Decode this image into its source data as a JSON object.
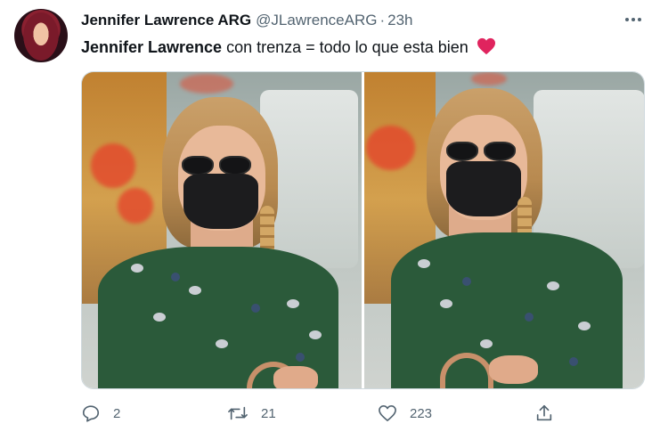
{
  "tweet": {
    "author_name": "Jennifer Lawrence ARG",
    "author_handle": "@JLawrenceARG",
    "separator": "·",
    "time": "23h",
    "text_mention": "Jennifer Lawrence",
    "text_rest": " con trenza = todo lo que esta bien",
    "emoji": "heart-emoji"
  },
  "media": {
    "photos": [
      "photo-left",
      "photo-right"
    ]
  },
  "actions": {
    "reply_count": "2",
    "retweet_count": "21",
    "like_count": "223"
  },
  "colors": {
    "text": "#0f1419",
    "secondary": "#536471",
    "heart": "#e0245e",
    "border": "#cfd9de",
    "dress": "#2b5a3a"
  },
  "icons": [
    "more-icon",
    "reply-icon",
    "retweet-icon",
    "like-icon",
    "share-icon"
  ]
}
